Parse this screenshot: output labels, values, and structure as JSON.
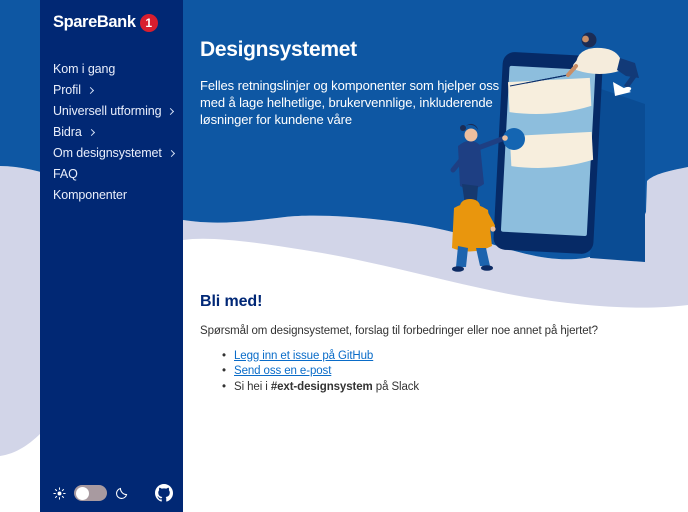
{
  "colors": {
    "sidebar_navy": "#012874",
    "hero_blue": "#0e57a3",
    "lavender": "#d2d5e8",
    "logo_red": "#d81e2e",
    "link_blue": "#0a6cc8",
    "text_dark": "#333333",
    "heading_navy": "#002776",
    "screen_blue": "#8dbedd",
    "card_cream": "#f7eedd",
    "orange": "#e9960d",
    "jeans": "#1d64ae",
    "toggle_track": "#a89aa0"
  },
  "sidebar": {
    "logo": {
      "text": "SpareBank",
      "badge": "1"
    },
    "items": [
      {
        "label": "Kom i gang",
        "chevron": false
      },
      {
        "label": "Profil",
        "chevron": true
      },
      {
        "label": "Universell utforming",
        "chevron": true
      },
      {
        "label": "Bidra",
        "chevron": true
      },
      {
        "label": "Om designsystemet",
        "chevron": true
      },
      {
        "label": "FAQ",
        "chevron": false
      },
      {
        "label": "Komponenter",
        "chevron": false
      }
    ],
    "footer": {
      "icons": [
        "sun",
        "theme-toggle",
        "moon",
        "github"
      ]
    }
  },
  "hero": {
    "title": "Designsystemet",
    "lines": [
      "Felles retningslinjer og komponenter som hjelper oss",
      "med å lage helhetlige, brukervennlige, inkluderende",
      "løsninger for kundene våre"
    ]
  },
  "join": {
    "heading": "Bli med!",
    "intro": "Spørsmål om designsystemet, forslag til forbedringer eller noe annet på hjertet?",
    "links": [
      {
        "label": "Legg inn et issue på GitHub"
      },
      {
        "label": "Send oss en e-post"
      }
    ],
    "slack": {
      "prefix": "Si hei i ",
      "channel": "#ext-designsystem",
      "suffix": " på Slack"
    }
  }
}
